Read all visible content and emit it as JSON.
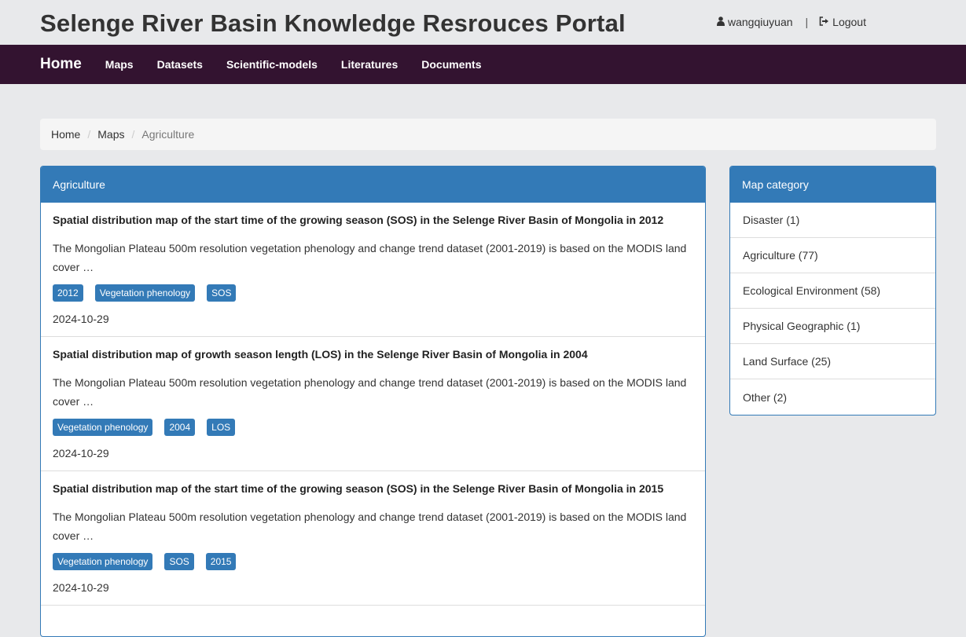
{
  "header": {
    "site_title": "Selenge River Basin Knowledge Resrouces Portal",
    "username": "wangqiuyuan",
    "separator": "|",
    "logout_label": "Logout"
  },
  "nav": {
    "home": "Home",
    "items": [
      "Maps",
      "Datasets",
      "Scientific-models",
      "Literatures",
      "Documents"
    ]
  },
  "breadcrumb": {
    "home": "Home",
    "maps": "Maps",
    "current": "Agriculture",
    "divider": "/"
  },
  "main": {
    "heading": "Agriculture",
    "items": [
      {
        "title": "Spatial distribution map of the start time of the growing season (SOS) in the Selenge River Basin of Mongolia in 2012",
        "desc": "The Mongolian Plateau 500m resolution vegetation phenology and change trend dataset (2001-2019) is based on the MODIS land cover …",
        "tags": [
          "2012",
          "Vegetation phenology",
          "SOS"
        ],
        "date": "2024-10-29"
      },
      {
        "title": "Spatial distribution map of growth season length (LOS) in the Selenge River Basin of Mongolia in 2004",
        "desc": "The Mongolian Plateau 500m resolution vegetation phenology and change trend dataset (2001-2019) is based on the MODIS land cover …",
        "tags": [
          "Vegetation phenology",
          "2004",
          "LOS"
        ],
        "date": "2024-10-29"
      },
      {
        "title": "Spatial distribution map of the start time of the growing season (SOS) in the Selenge River Basin of Mongolia in 2015",
        "desc": "The Mongolian Plateau 500m resolution vegetation phenology and change trend dataset (2001-2019) is based on the MODIS land cover …",
        "tags": [
          "Vegetation phenology",
          "SOS",
          "2015"
        ],
        "date": "2024-10-29"
      }
    ]
  },
  "sidebar": {
    "heading": "Map category",
    "categories": [
      "Disaster (1)",
      "Agriculture (77)",
      "Ecological Environment (58)",
      "Physical Geographic (1)",
      "Land Surface (25)",
      "Other (2)"
    ]
  },
  "colors": {
    "primary": "#337ab7",
    "navbar": "#331330",
    "background": "#e8e9eb"
  },
  "icons": {
    "user": "user-icon",
    "logout": "sign-out-icon"
  }
}
